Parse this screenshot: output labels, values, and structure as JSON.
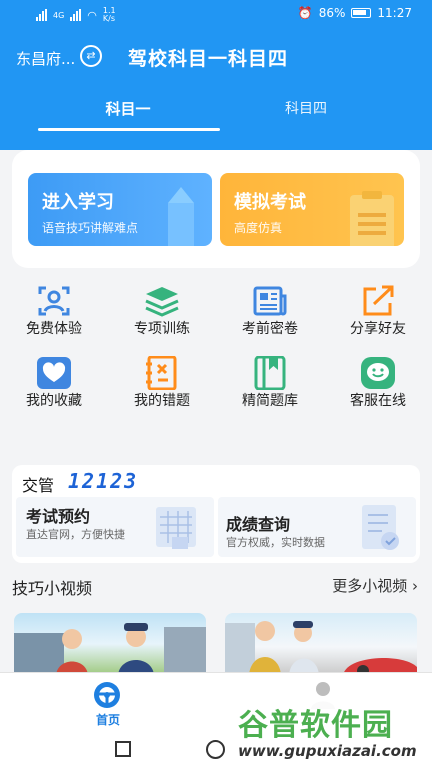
{
  "status": {
    "network": "4G",
    "speed": "1.1\nK/s",
    "battery": "86%",
    "time": "11:27"
  },
  "header": {
    "city": "东昌府...",
    "title": "驾校科目一科目四",
    "tabs": [
      "科目一",
      "科目四"
    ]
  },
  "primary": [
    {
      "title": "进入学习",
      "subtitle": "语音技巧讲解难点"
    },
    {
      "title": "模拟考试",
      "subtitle": "高度仿真"
    }
  ],
  "grid": [
    {
      "label": "免费体验",
      "icon": "face-scan-icon",
      "color": "#3f86e0"
    },
    {
      "label": "专项训练",
      "icon": "stack-layers-icon",
      "color": "#36b37e"
    },
    {
      "label": "考前密卷",
      "icon": "newspaper-icon",
      "color": "#3f86e0"
    },
    {
      "label": "分享好友",
      "icon": "share-arrow-icon",
      "color": "#ff8c1a"
    },
    {
      "label": "我的收藏",
      "icon": "heart-icon",
      "color": "#3f86e0"
    },
    {
      "label": "我的错题",
      "icon": "wrong-notebook-icon",
      "color": "#ff8c1a"
    },
    {
      "label": "精简题库",
      "icon": "book-icon",
      "color": "#36b37e"
    },
    {
      "label": "客服在线",
      "icon": "chat-smile-icon",
      "color": "#36b37e"
    }
  ],
  "jg12123": {
    "label": "交管",
    "number": "12123",
    "booking": {
      "title": "考试预约",
      "subtitle": "直达官网，方便快捷"
    },
    "score": {
      "title": "成绩查询",
      "subtitle": "官方权威，实时数据"
    }
  },
  "videos": {
    "title": "技巧小视频",
    "more": "更多小视频"
  },
  "tabbar": {
    "home": "首页"
  },
  "watermark": {
    "title": "谷普软件园",
    "url": "www.gupuxiazai.com"
  },
  "colors": {
    "primary": "#2196f3",
    "study": "#4aa6fb",
    "exam": "#ffbb45",
    "accent": "#1e7fe0"
  }
}
